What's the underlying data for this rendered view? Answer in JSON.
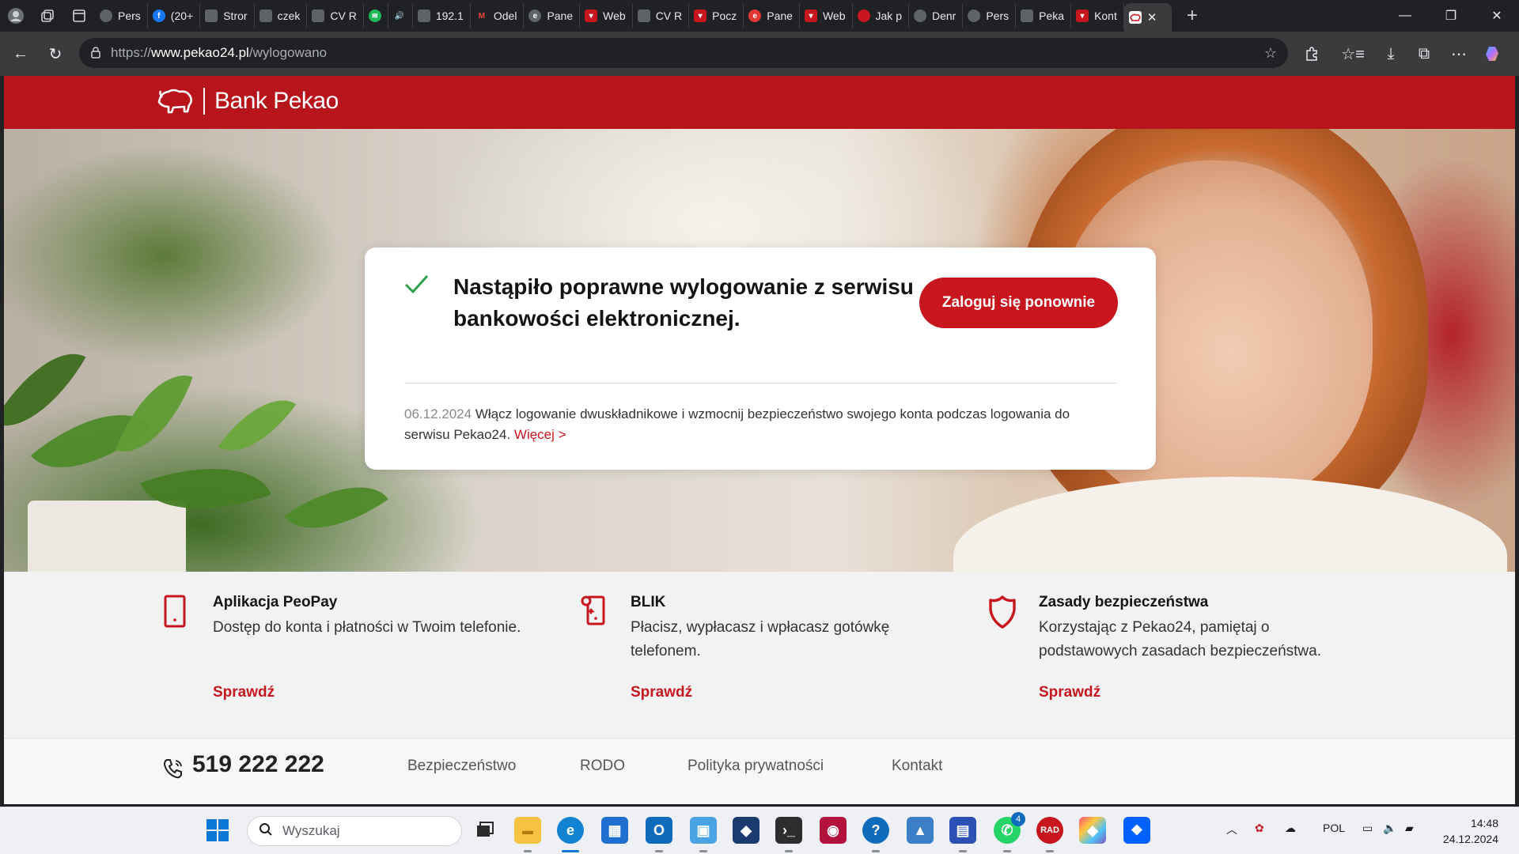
{
  "browser": {
    "tabs": [
      {
        "title": "Pers",
        "icon": "profile-icon",
        "color": "#5f6368"
      },
      {
        "title": "(20+",
        "icon": "facebook-icon",
        "color": "#1877f2"
      },
      {
        "title": "Stror",
        "icon": "page-icon",
        "color": "#5f6368"
      },
      {
        "title": "czek",
        "icon": "doc-icon",
        "color": "#5f6368"
      },
      {
        "title": "CV R",
        "icon": "page-icon",
        "color": "#5f6368"
      },
      {
        "title": "",
        "icon": "spotify-icon",
        "color": "#1db954"
      },
      {
        "title": "",
        "icon": "speaker-icon",
        "color": "#202124"
      },
      {
        "title": "192.1",
        "icon": "doc-icon",
        "color": "#5f6368"
      },
      {
        "title": "Odel",
        "icon": "gmail-icon",
        "color": "#ea4335"
      },
      {
        "title": "Pane",
        "icon": "e-icon",
        "color": "#5f6368"
      },
      {
        "title": "Web",
        "icon": "pekao-icon",
        "color": "#c8161e"
      },
      {
        "title": "CV R",
        "icon": "page-icon",
        "color": "#5f6368"
      },
      {
        "title": "Pocz",
        "icon": "mail-icon",
        "color": "#c8161e"
      },
      {
        "title": "Pane",
        "icon": "e-icon",
        "color": "#e53935"
      },
      {
        "title": "Web",
        "icon": "pekao-icon",
        "color": "#c8161e"
      },
      {
        "title": "Jak p",
        "icon": "circle-icon",
        "color": "#c8161e"
      },
      {
        "title": "Denr",
        "icon": "profile-icon",
        "color": "#5f6368"
      },
      {
        "title": "Pers",
        "icon": "profile-icon",
        "color": "#5f6368"
      },
      {
        "title": "Peka",
        "icon": "page-icon",
        "color": "#5f6368"
      },
      {
        "title": "Kont",
        "icon": "pekao-icon",
        "color": "#c8161e"
      }
    ],
    "active_tab_icon": "pekao-icon",
    "url_scheme": "https://",
    "url_host": "www.pekao24.pl",
    "url_path": "/wylogowano"
  },
  "site": {
    "logo_text": "Bank Pekao",
    "brand_color": "#b8141c",
    "logout_message": "Nastąpiło poprawne wylogowanie z serwisu bankowości elektronicznej.",
    "relogin_button": "Zaloguj się ponownie",
    "news": {
      "date": "06.12.2024",
      "text": " Włącz logowanie dwuskładnikowe i wzmocnij bezpieczeństwo swojego konta podczas logowania do serwisu Pekao24. ",
      "more": "Więcej >"
    },
    "features": [
      {
        "title": "Aplikacja PeoPay",
        "desc": "Dostęp do konta i płatności w Twoim telefonie.",
        "link": "Sprawdź",
        "icon": "phone-device-icon"
      },
      {
        "title": "BLIK",
        "desc": "Płacisz, wypłacasz i wpłacasz gotówkę telefonem.",
        "link": "Sprawdź",
        "icon": "blik-icon"
      },
      {
        "title": "Zasady bezpieczeństwa",
        "desc": "Korzystając z Pekao24, pamiętaj o podstawowych zasadach bezpieczeństwa.",
        "link": "Sprawdź",
        "icon": "shield-icon"
      }
    ],
    "footer": {
      "phone": "519 222 222",
      "links": [
        "Bezpieczeństwo",
        "RODO",
        "Polityka prywatności",
        "Kontakt"
      ]
    }
  },
  "taskbar": {
    "search_placeholder": "Wyszukaj",
    "whatsapp_badge": "4",
    "language": "POL",
    "time": "14:48",
    "date": "24.12.2024"
  }
}
